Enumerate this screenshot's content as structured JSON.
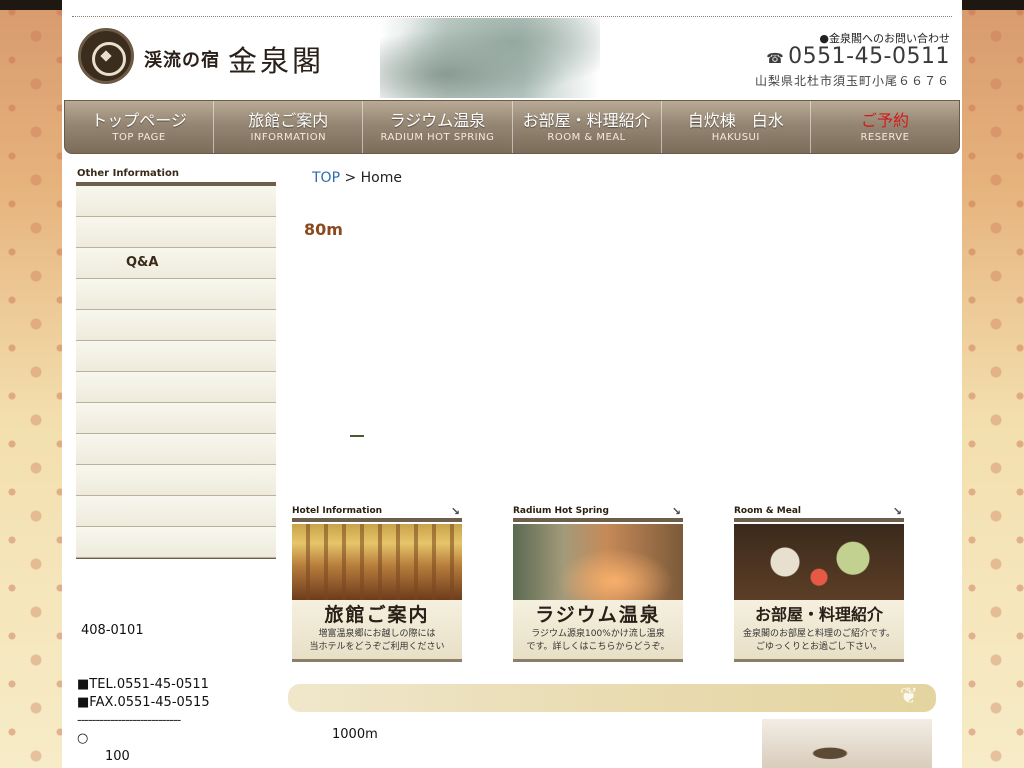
{
  "header": {
    "logo_sub": "渓流の宿",
    "logo_main": "金泉閣",
    "contact_heading": "●金泉閣へのお問い合わせ",
    "phone_icon": "☎",
    "phone": "0551-45-0511",
    "address": "山梨県北杜市須玉町小尾６６７６"
  },
  "nav": [
    {
      "jp": "トップページ",
      "en": "TOP PAGE"
    },
    {
      "jp": "旅館ご案内",
      "en": "INFORMATION"
    },
    {
      "jp": "ラジウム温泉",
      "en": "RADIUM HOT SPRING"
    },
    {
      "jp": "お部屋・料理紹介",
      "en": "ROOM & MEAL"
    },
    {
      "jp": "自炊棟　白水",
      "en": "HAKUSUI"
    },
    {
      "jp": "ご予約",
      "en": "RESERVE"
    }
  ],
  "sidebar": {
    "title": "Other Information",
    "items": [
      "",
      "",
      "Q&A",
      "",
      "",
      "",
      "",
      "",
      "",
      "",
      "",
      ""
    ],
    "zip": "408-0101",
    "tel": "■TEL.0551-45-0511",
    "fax": "■FAX.0551-45-0515",
    "divider": "----------------------------",
    "bullet": "○",
    "note": "100"
  },
  "breadcrumb": {
    "top": "TOP",
    "separator": ">",
    "current": "Home"
  },
  "main": {
    "heading": "80m",
    "distance": "1000m"
  },
  "features": [
    {
      "head": "Hotel Information",
      "label": "旅館ご案内",
      "desc1": "増富温泉郷にお越しの際には",
      "desc2": "当ホテルをどうぞご利用ください"
    },
    {
      "head": "Radium Hot Spring",
      "label": "ラジウム温泉",
      "desc1": "ラジウム源泉100%かけ流し温泉",
      "desc2": "です。詳しくはこちらからどうぞ。"
    },
    {
      "head": "Room & Meal",
      "label": "お部屋・料理紹介",
      "desc1": "金泉閣のお部屋と料理のご紹介です。",
      "desc2": "ごゆっくりとお過ごし下さい。"
    }
  ],
  "icons": {
    "feature_arrow": "↘",
    "logo": "crest-icon"
  },
  "colors": {
    "accent_brown": "#6e5f4d",
    "heading_brown": "#8a4a1e",
    "reserve_red": "#d21a1a",
    "link_blue": "#2b6cb0"
  }
}
